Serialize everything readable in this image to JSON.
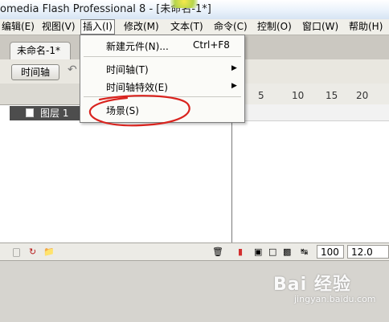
{
  "window": {
    "title": "omedia Flash Professional 8 - [未命名-1*]"
  },
  "menubar": {
    "items": [
      "编辑(E)",
      "视图(V)",
      "插入(I)",
      "修改(M)",
      "文本(T)",
      "命令(C)",
      "控制(O)",
      "窗口(W)",
      "帮助(H)"
    ]
  },
  "insert_menu": {
    "new_symbol": {
      "label": "新建元件(N)...",
      "shortcut": "Ctrl+F8"
    },
    "timeline": {
      "label": "时间轴(T)"
    },
    "timeline_effects": {
      "label": "时间轴特效(E)"
    },
    "scene": {
      "label": "场景(S)"
    }
  },
  "document": {
    "tab_label": "未命名-1*"
  },
  "timeline": {
    "button_label": "时间轴",
    "ruler_ticks": [
      "5",
      "10",
      "15",
      "20"
    ],
    "layer_name": "图层 1"
  },
  "status": {
    "current_frame": "100",
    "frame_rate": "12.0 fps"
  },
  "watermark": {
    "brand": "Bai  经验",
    "site": "jingyan.baidu.com"
  },
  "colors": {
    "annotation_red": "#d9231e",
    "layer_selected": "#4d4d4d"
  },
  "icons": [
    "add-layer-icon",
    "add-motion-guide-icon",
    "insert-folder-icon",
    "trash-icon",
    "playhead-icon",
    "onion-skin-icon",
    "onion-skin-outline-icon",
    "edit-multiple-frames-icon",
    "modify-markers-icon",
    "center-frame-icon"
  ]
}
